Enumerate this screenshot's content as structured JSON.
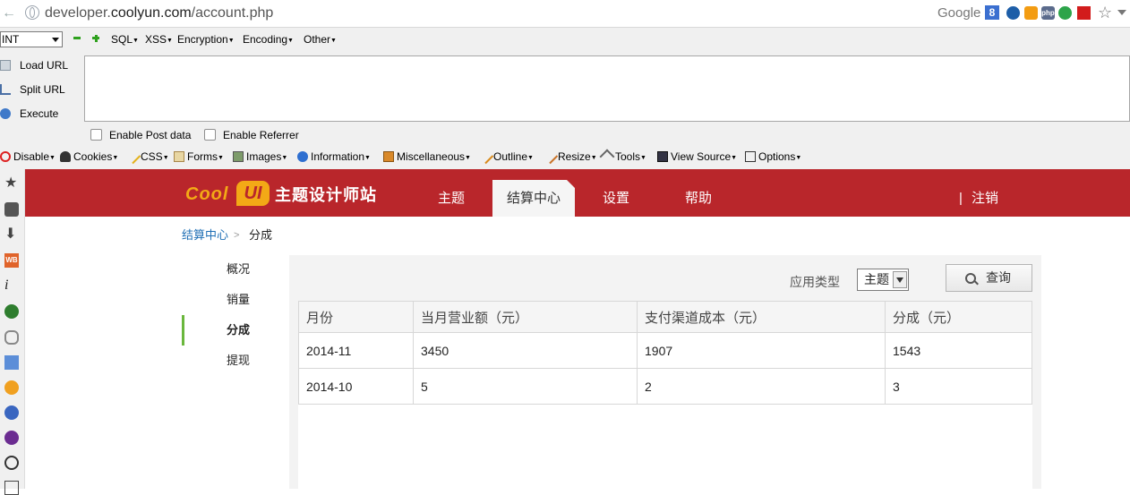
{
  "browser": {
    "url_prefix": "developer.",
    "url_domain": "coolyun.com",
    "url_path": "/account.php",
    "search_engine": "Google",
    "search_badge": "8",
    "php_badge": "php"
  },
  "hackbar": {
    "int_select": "INT",
    "menus": [
      "SQL",
      "XSS",
      "Encryption",
      "Encoding",
      "Other"
    ],
    "actions": [
      "Load URL",
      "Split URL",
      "Execute"
    ],
    "checkboxes": [
      "Enable Post data",
      "Enable Referrer"
    ]
  },
  "webdev": {
    "items": [
      "Disable",
      "Cookies",
      "CSS",
      "Forms",
      "Images",
      "Information",
      "Miscellaneous",
      "Outline",
      "Resize",
      "Tools",
      "View Source",
      "Options"
    ]
  },
  "site": {
    "logo_cool": "Cool",
    "logo_ui": "UI",
    "logo_site": "主题设计师站",
    "nav": [
      "主题",
      "结算中心",
      "设置",
      "帮助"
    ],
    "logout_sep": "|",
    "logout": "注销",
    "accent": "#b9262b"
  },
  "breadcrumb": {
    "parent": "结算中心",
    "sep": ">",
    "current": "分成"
  },
  "subnav": [
    "概况",
    "销量",
    "分成",
    "提现"
  ],
  "filter": {
    "label": "应用类型",
    "selected": "主题",
    "query_button": "查询"
  },
  "table": {
    "headers": [
      "月份",
      "当月营业额（元）",
      "支付渠道成本（元）",
      "分成（元）"
    ],
    "rows": [
      [
        "2014-11",
        "3450",
        "1907",
        "1543"
      ],
      [
        "2014-10",
        "5",
        "2",
        "3"
      ]
    ]
  }
}
